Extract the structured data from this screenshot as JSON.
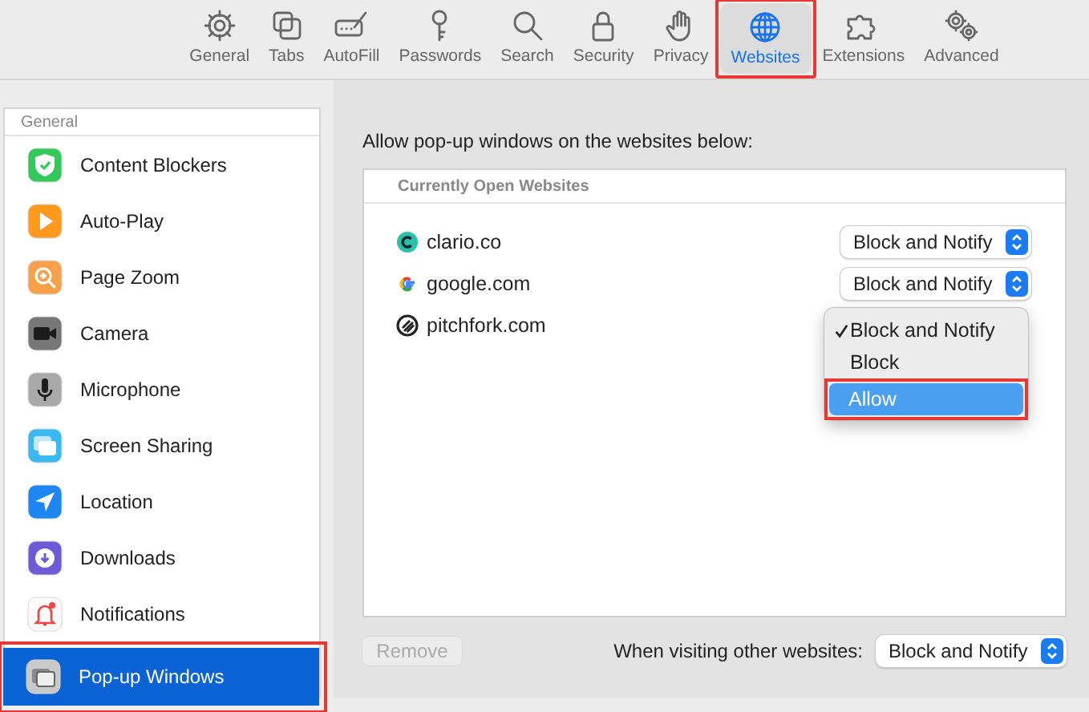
{
  "toolbar": {
    "items": [
      {
        "label": "General",
        "selected": false,
        "highlighted": false
      },
      {
        "label": "Tabs",
        "selected": false,
        "highlighted": false
      },
      {
        "label": "AutoFill",
        "selected": false,
        "highlighted": false
      },
      {
        "label": "Passwords",
        "selected": false,
        "highlighted": false
      },
      {
        "label": "Search",
        "selected": false,
        "highlighted": false
      },
      {
        "label": "Security",
        "selected": false,
        "highlighted": false
      },
      {
        "label": "Privacy",
        "selected": false,
        "highlighted": false
      },
      {
        "label": "Websites",
        "selected": true,
        "highlighted": true
      },
      {
        "label": "Extensions",
        "selected": false,
        "highlighted": false
      },
      {
        "label": "Advanced",
        "selected": false,
        "highlighted": false
      }
    ]
  },
  "sidebar": {
    "section": "General",
    "items": [
      {
        "label": "Content Blockers",
        "selected": false,
        "highlighted": false
      },
      {
        "label": "Auto-Play",
        "selected": false,
        "highlighted": false
      },
      {
        "label": "Page Zoom",
        "selected": false,
        "highlighted": false
      },
      {
        "label": "Camera",
        "selected": false,
        "highlighted": false
      },
      {
        "label": "Microphone",
        "selected": false,
        "highlighted": false
      },
      {
        "label": "Screen Sharing",
        "selected": false,
        "highlighted": false
      },
      {
        "label": "Location",
        "selected": false,
        "highlighted": false
      },
      {
        "label": "Downloads",
        "selected": false,
        "highlighted": false
      },
      {
        "label": "Notifications",
        "selected": false,
        "highlighted": false
      },
      {
        "label": "Pop-up Windows",
        "selected": true,
        "highlighted": true
      }
    ]
  },
  "content": {
    "description": "Allow pop-up windows on the websites below:",
    "list_header": "Currently Open Websites",
    "sites": [
      {
        "name": "clario.co",
        "setting": "Block and Notify"
      },
      {
        "name": "google.com",
        "setting": "Block and Notify"
      },
      {
        "name": "pitchfork.com",
        "menu": {
          "options": [
            {
              "label": "Block and Notify",
              "checked": true,
              "selected": false,
              "highlighted": false
            },
            {
              "label": "Block",
              "checked": false,
              "selected": false,
              "highlighted": false
            },
            {
              "label": "Allow",
              "checked": false,
              "selected": true,
              "highlighted": true
            }
          ]
        }
      }
    ],
    "remove_button": {
      "label": "Remove",
      "disabled": true
    },
    "other_websites_label": "When visiting other websites:",
    "other_websites_setting": "Block and Notify"
  }
}
